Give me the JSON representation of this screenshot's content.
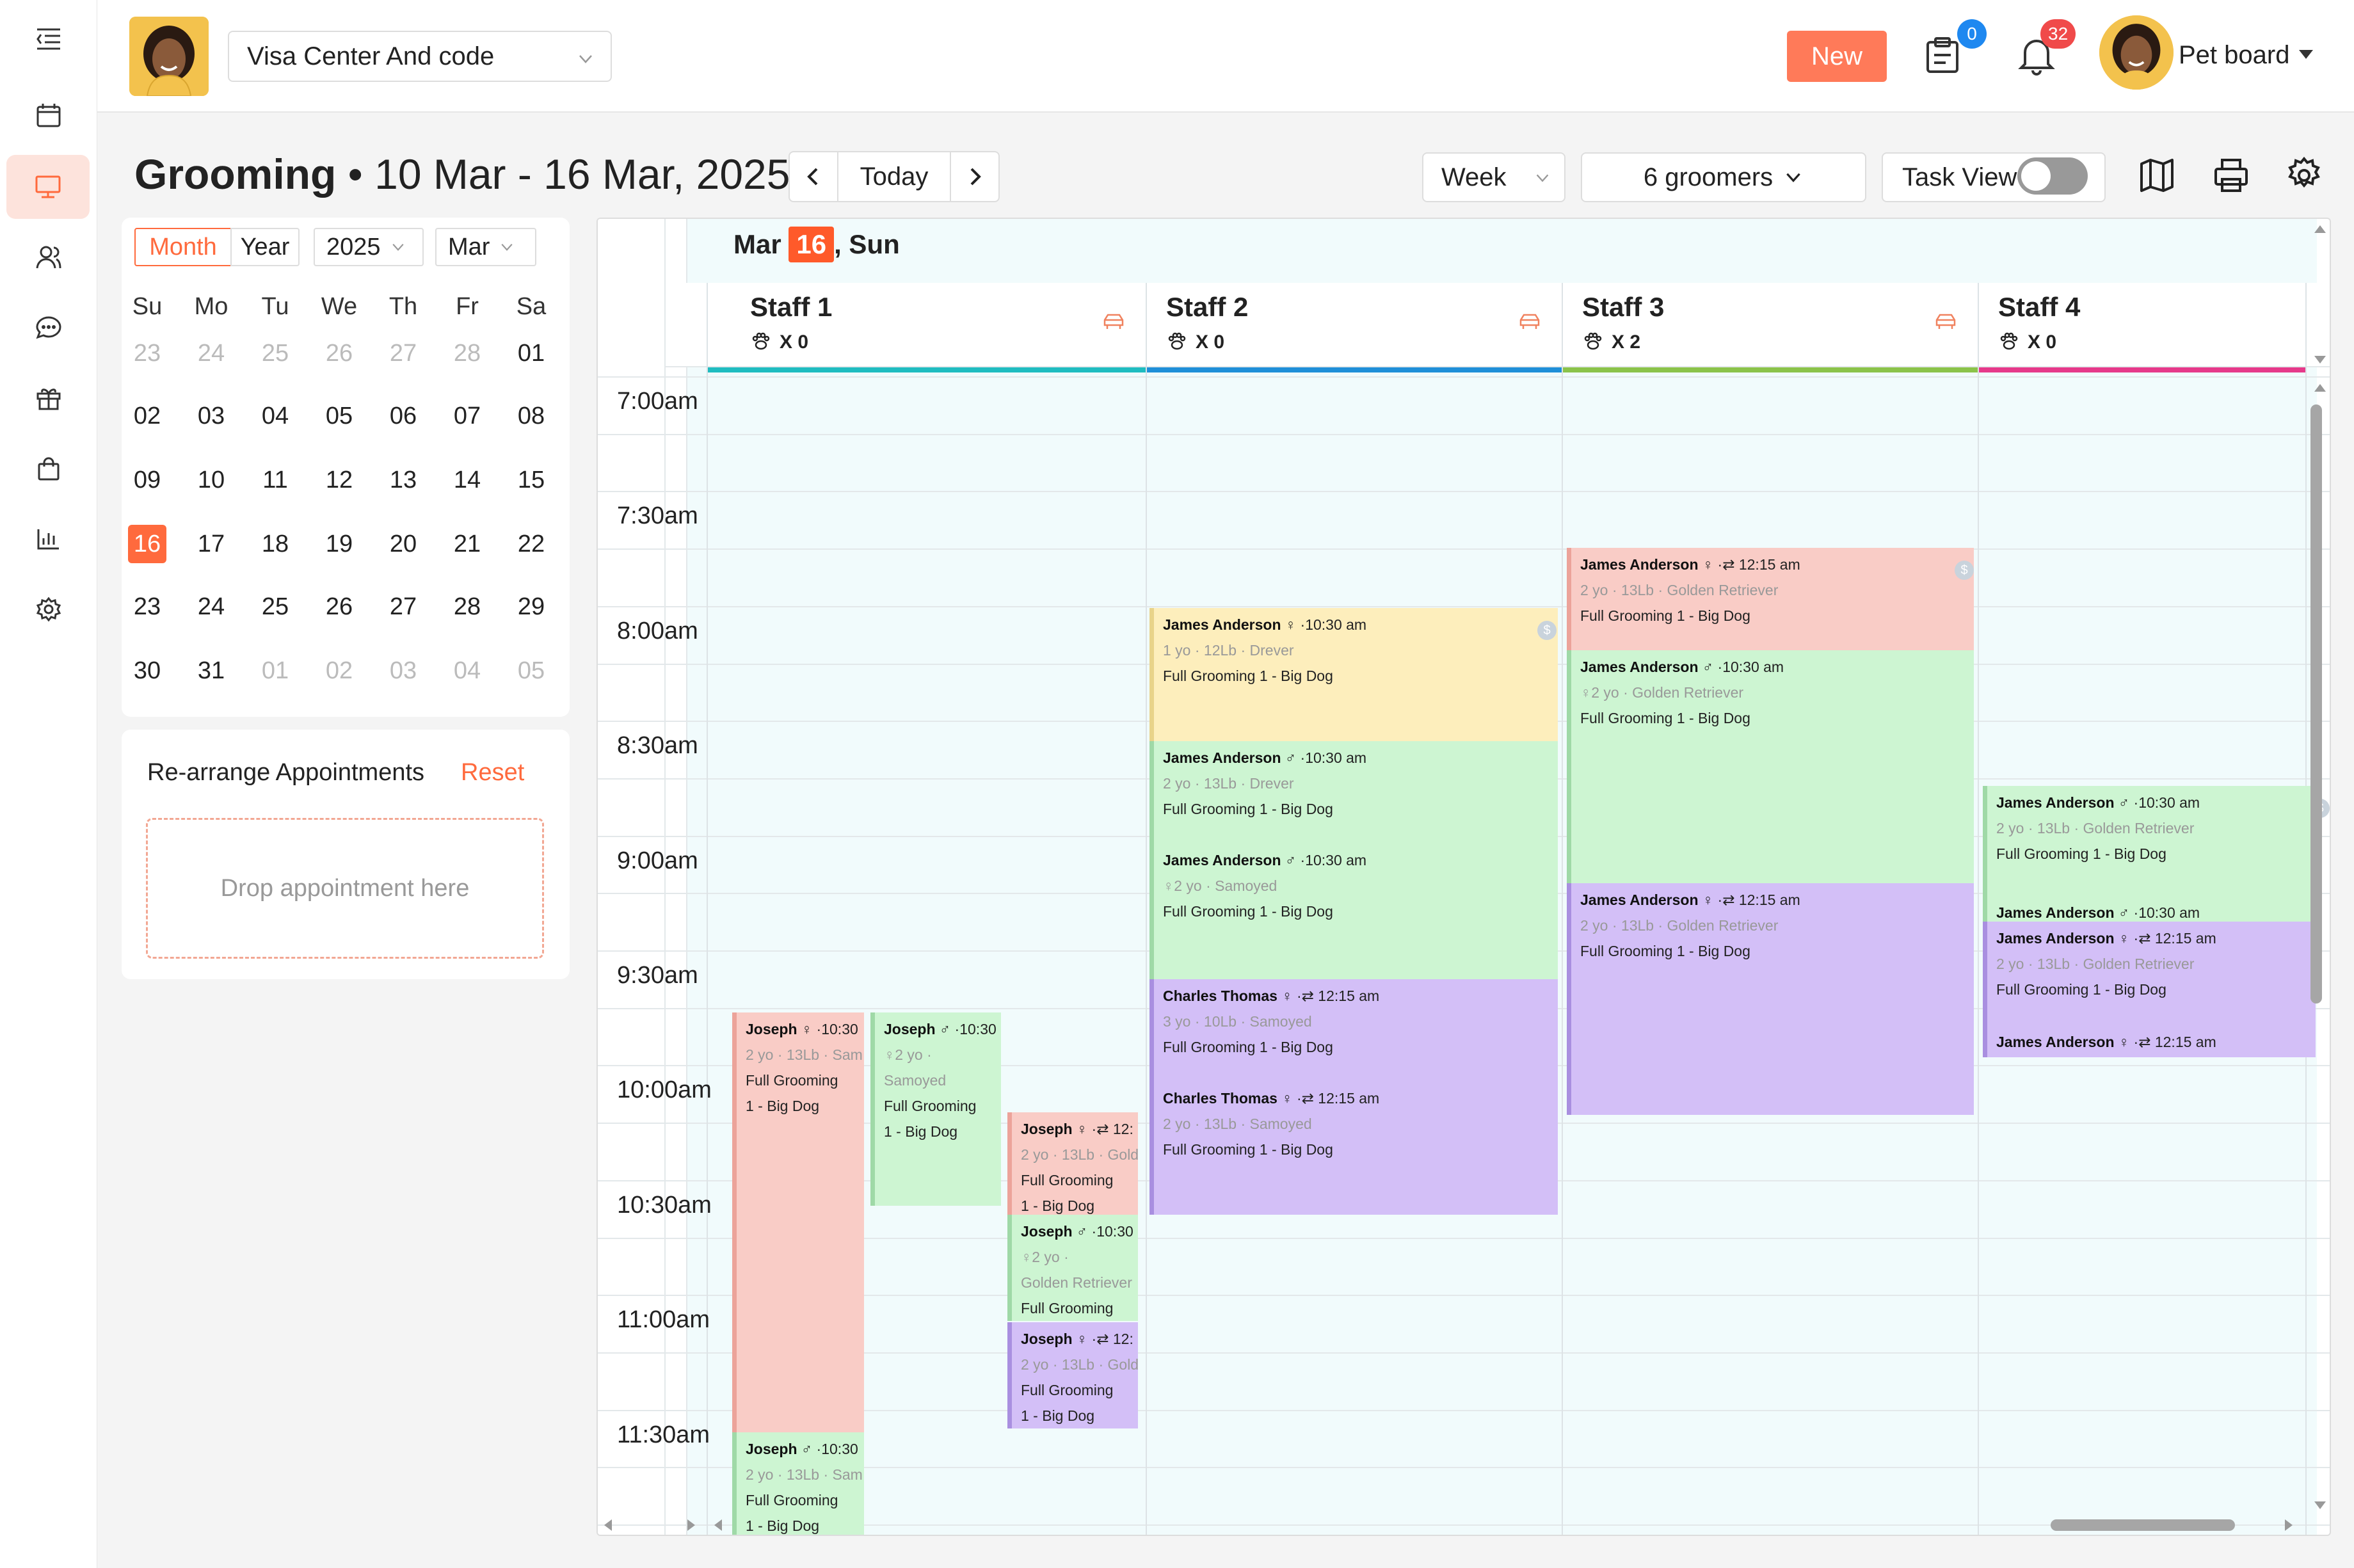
{
  "topbar": {
    "location": "Visa Center And code",
    "new_label": "New",
    "clipboard_badge": "0",
    "bell_badge": "32",
    "user_name": "Pet board"
  },
  "header": {
    "module": "Grooming",
    "separator": "•",
    "date_range": "10 Mar - 16 Mar, 2025",
    "today_label": "Today",
    "view_select": "Week",
    "groomers_select": "6 groomers",
    "task_view_label": "Task View"
  },
  "mini_calendar": {
    "tab_month": "Month",
    "tab_year": "Year",
    "year": "2025",
    "month": "Mar",
    "weekdays": [
      "Su",
      "Mo",
      "Tu",
      "We",
      "Th",
      "Fr",
      "Sa"
    ],
    "weeks": [
      [
        "23",
        "24",
        "25",
        "26",
        "27",
        "28",
        "01"
      ],
      [
        "02",
        "03",
        "04",
        "05",
        "06",
        "07",
        "08"
      ],
      [
        "09",
        "10",
        "11",
        "12",
        "13",
        "14",
        "15"
      ],
      [
        "16",
        "17",
        "18",
        "19",
        "20",
        "21",
        "22"
      ],
      [
        "23",
        "24",
        "25",
        "26",
        "27",
        "28",
        "29"
      ],
      [
        "30",
        "31",
        "01",
        "02",
        "03",
        "04",
        "05"
      ]
    ],
    "selected_day": "16"
  },
  "rearrange": {
    "title": "Re-arrange Appointments",
    "reset_label": "Reset",
    "drop_placeholder": "Drop appointment here"
  },
  "day_header": {
    "month": "Mar",
    "day": "16",
    "weekday": ", Sun"
  },
  "staff": [
    {
      "name": "Staff 1",
      "count": "X 0",
      "color": "#1fbcc0"
    },
    {
      "name": "Staff 2",
      "count": "X 0",
      "color": "#1f8fd8"
    },
    {
      "name": "Staff 3",
      "count": "X 2",
      "color": "#8bc34a"
    },
    {
      "name": "Staff 4",
      "count": "X 0",
      "color": "#e6398a"
    }
  ],
  "times": [
    "7:00am",
    "7:30am",
    "8:00am",
    "8:30am",
    "9:00am",
    "9:30am",
    "10:00am",
    "10:30am",
    "11:00am",
    "11:30am"
  ],
  "appointments": [
    {
      "name": "Joseph",
      "icons": "♀ ·10:30",
      "meta": "2 yo · 13Lb · Sam",
      "service": "Full Grooming",
      "service2": "1  - Big Dog",
      "bg": "#f9ccc6",
      "border": "#eca39a"
    },
    {
      "name": "Joseph",
      "icons": "♂ ·10:30",
      "meta": "♀2 yo ·",
      "meta2": "Samoyed",
      "service": "Full Grooming",
      "service2": "1  - Big Dog",
      "bg": "#cdf5d2",
      "border": "#9fd9a7"
    },
    {
      "name": "Joseph",
      "icons": "♀ ·⇄ 12:",
      "meta": "2 yo · 13Lb · Gold",
      "service": "Full Grooming",
      "service2": "1  - Big Dog",
      "bg": "#f9ccc6",
      "border": "#eca39a"
    },
    {
      "name": "Joseph",
      "icons": "♂ ·10:30",
      "meta": "♀2 yo ·",
      "meta2": "Golden Retriever",
      "service": "Full Grooming",
      "bg": "#cdf5d2",
      "border": "#9fd9a7"
    },
    {
      "name": "Joseph",
      "icons": "♀ ·⇄ 12:",
      "meta": "2 yo · 13Lb · Gold",
      "service": "Full Grooming",
      "service2": "1  - Big Dog",
      "bg": "#d3bff7",
      "border": "#a98fe0"
    },
    {
      "name": "Joseph",
      "icons": "♂ ·10:30",
      "meta": "2 yo · 13Lb · Sam",
      "service": "Full Grooming",
      "service2": "1  - Big Dog",
      "bg": "#cdf5d2",
      "border": "#9fd9a7"
    },
    {
      "name": "James Anderson",
      "icons": "♀ ·10:30 am",
      "meta": "1 yo · 12Lb · Drever",
      "service": "Full Grooming 1  - Big Dog",
      "bg": "#fdeebc",
      "border": "#e8d38a"
    },
    {
      "name": "James Anderson",
      "icons": "♂ ·10:30 am",
      "meta": "2 yo · 13Lb · Drever",
      "service": "Full Grooming 1  - Big Dog",
      "bg": "#cdf5d2",
      "border": "#9fd9a7"
    },
    {
      "name": "James Anderson",
      "icons": "♂ ·10:30 am",
      "meta": "♀2 yo · Samoyed",
      "service": "Full Grooming 1  - Big Dog",
      "bg": "#cdf5d2",
      "border": "#9fd9a7"
    },
    {
      "name": "Charles Thomas",
      "icons": "♀ ·⇄ 12:15 am",
      "meta": "3 yo · 10Lb · Samoyed",
      "service": "Full Grooming 1  - Big Dog",
      "bg": "#d3bff7",
      "border": "#a98fe0"
    },
    {
      "name": "Charles Thomas",
      "icons": "♀ ·⇄ 12:15 am",
      "meta": "2 yo · 13Lb · Samoyed",
      "service": "Full Grooming 1  - Big Dog",
      "bg": "#d3bff7",
      "border": "#a98fe0"
    },
    {
      "name": "James Anderson",
      "icons": "♀ ·⇄ 12:15 am",
      "meta": "2 yo · 13Lb · Golden Retriever",
      "service": "Full Grooming 1  - Big Dog",
      "bg": "#f9ccc6",
      "border": "#eca39a"
    },
    {
      "name": "James Anderson",
      "icons": "♂ ·10:30 am",
      "meta": "♀2 yo · Golden Retriever",
      "service": "Full Grooming 1  - Big Dog",
      "bg": "#cdf5d2",
      "border": "#9fd9a7"
    },
    {
      "name": "James Anderson",
      "icons": "♀ ·⇄ 12:15 am",
      "meta": "2 yo · 13Lb · Golden Retriever",
      "service": "Full Grooming 1  - Big Dog",
      "bg": "#d3bff7",
      "border": "#a98fe0"
    },
    {
      "name": "James Anderson",
      "icons": "♂ ·10:30 am",
      "meta": "2 yo · 13Lb · Golden Retriever",
      "service": "Full Grooming 1  - Big Dog",
      "bg": "#cdf5d2",
      "border": "#9fd9a7"
    },
    {
      "name": "James Anderson",
      "icons": "♂ ·10:30 am",
      "bg": "#cdf5d2",
      "border": "#9fd9a7"
    },
    {
      "name": "James Anderson",
      "icons": "♀ ·⇄ 12:15 am",
      "meta": "2 yo · 13Lb · Golden Retriever",
      "service": "Full Grooming 1  - Big Dog",
      "bg": "#d3bff7",
      "border": "#a98fe0"
    },
    {
      "name": "James Anderson",
      "icons": "♀ ·⇄ 12:15 am",
      "bg": "#d3bff7",
      "border": "#a98fe0"
    }
  ]
}
